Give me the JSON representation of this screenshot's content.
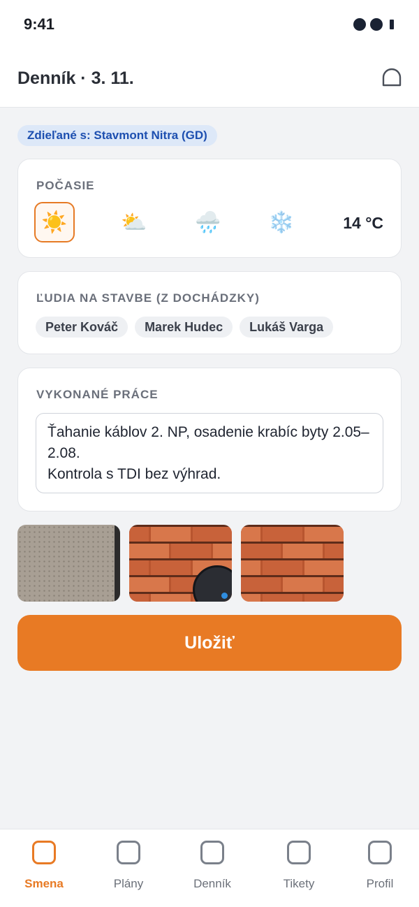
{
  "status": {
    "time": "9:41"
  },
  "header": {
    "title": "Denník · 3. 11."
  },
  "share_badge": "Zdieľané s: Stavmont Nitra (GD)",
  "weather": {
    "title": "POČASIE",
    "options": [
      {
        "icon": "sun-icon",
        "glyph": "☀️",
        "selected": true
      },
      {
        "icon": "partly-cloudy-icon",
        "glyph": "⛅",
        "selected": false
      },
      {
        "icon": "rain-cloud-icon",
        "glyph": "🌧️",
        "selected": false
      },
      {
        "icon": "snowflake-icon",
        "glyph": "❄️",
        "selected": false
      }
    ],
    "temperature": "14 °C"
  },
  "people": {
    "title": "ĽUDIA NA STAVBE (Z DOCHÁDZKY)",
    "names": [
      "Peter Kováč",
      "Marek Hudec",
      "Lukáš Varga"
    ]
  },
  "works": {
    "title": "VYKONANÉ PRÁCE",
    "text": "Ťahanie káblov 2. NP, osadenie krabíc byty 2.05–2.08.\nKontrola s TDI bez výhrad."
  },
  "save_label": "Uložiť",
  "tabs": [
    {
      "label": "Smena",
      "active": true
    },
    {
      "label": "Plány",
      "active": false
    },
    {
      "label": "Denník",
      "active": false
    },
    {
      "label": "Tikety",
      "active": false
    },
    {
      "label": "Profil",
      "active": false
    }
  ],
  "colors": {
    "accent": "#e87a24",
    "badge_bg": "#dde8f8",
    "badge_text": "#1d4fb0"
  }
}
